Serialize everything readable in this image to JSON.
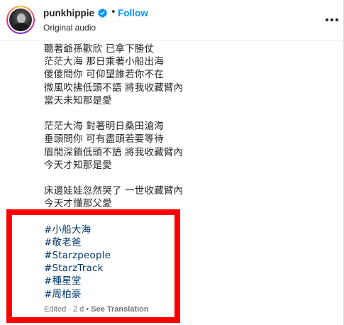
{
  "post": {
    "username": "punkhippie",
    "separator": "•",
    "follow_label": "Follow",
    "audio": "Original audio"
  },
  "caption": {
    "lines": [
      "聽著爺孫歡欣 已拿下勝仗",
      "茫茫大海 那日乘著小船出海",
      "傻傻問你 可仰望誰若你不在",
      "微風吹拂低頭不語 將我收藏臂內",
      "當天未知那是愛",
      "",
      "茫茫大海 對著明日桑田滄海",
      "垂頭問你 可有盡頭若要等待",
      "眉間深鎖低頭不語 將我收藏臂內",
      "今天才知那是愛",
      "",
      "床邊娃娃忽然哭了 一世收藏臂內",
      "今天才懂那父愛",
      ""
    ],
    "hashtags": [
      "#小船大海",
      "#敬老爸",
      "#Starzpeople",
      "#StarzTrack",
      "#種星堂",
      "#周柏豪"
    ]
  },
  "meta": {
    "edited": "Edited · 2 d",
    "separator": "•",
    "see_translation": "See Translation"
  },
  "icons": {
    "verified": "verified-badge-icon",
    "more": "more-options-icon"
  },
  "colors": {
    "follow": "#0095f6",
    "hashtag": "#00376b",
    "highlight_box": "#ff0000",
    "verified": "#0095f6"
  }
}
